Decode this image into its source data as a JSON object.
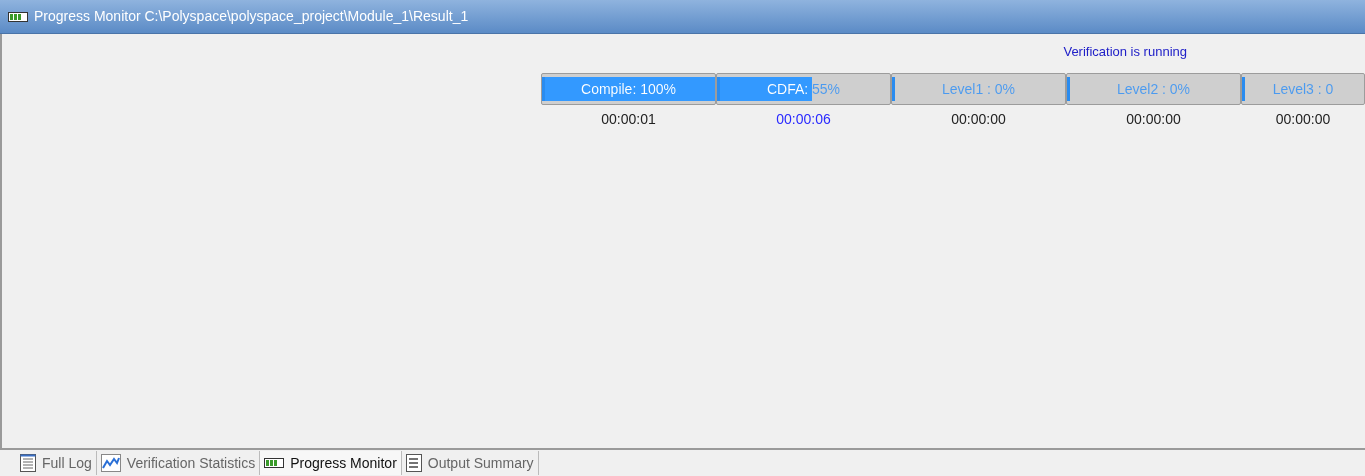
{
  "window": {
    "title": "Progress Monitor C:\\Polyspace\\polyspace_project\\Module_1\\Result_1"
  },
  "status": "Verification is running",
  "stages": [
    {
      "label": "Compile: 100%",
      "level": 1,
      "time": "00:00:01",
      "running": false
    },
    {
      "label": "CDFA: 55%",
      "level": 0.55,
      "time": "00:00:06",
      "running": true
    },
    {
      "label": "Level1 : 0%",
      "level": 0,
      "time": "00:00:00",
      "running": false
    },
    {
      "label": "Level2 : 0%",
      "level": 0,
      "time": "00:00:00",
      "running": false
    },
    {
      "label": "Level3 : 0",
      "level": 0,
      "time": "00:00:00",
      "running": false
    }
  ],
  "tabs": [
    {
      "label": "Full Log",
      "kind": "log",
      "selected": false
    },
    {
      "label": "Verification Statistics",
      "kind": "stats",
      "selected": false
    },
    {
      "label": "Progress Monitor",
      "kind": "progress",
      "selected": true
    },
    {
      "label": "Output Summary",
      "kind": "summary",
      "selected": false
    }
  ]
}
